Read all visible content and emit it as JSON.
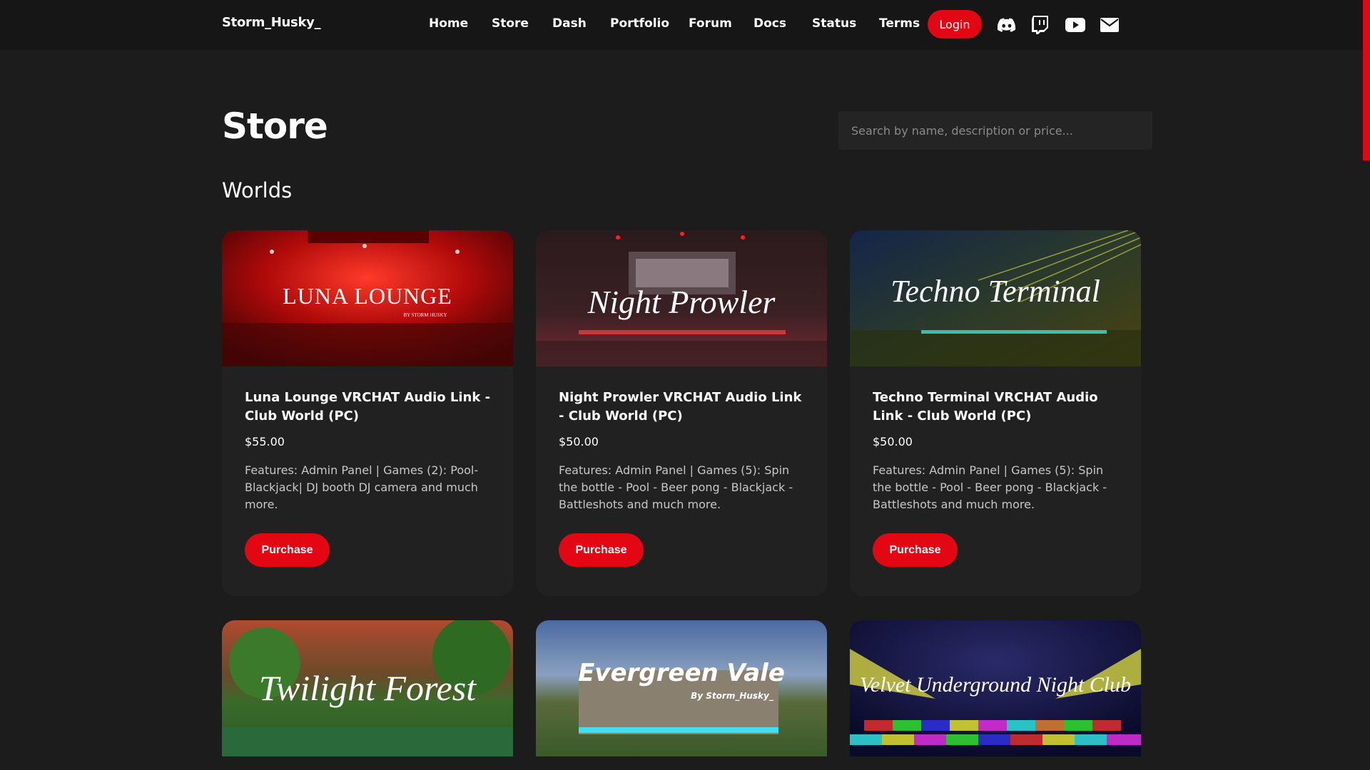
{
  "header": {
    "brand": "Storm_Husky_",
    "nav": [
      "Home",
      "Store",
      "Dash",
      "Portfolio",
      "Forum",
      "Docs",
      "Status",
      "Terms"
    ],
    "login_label": "Login",
    "social_icons": [
      "discord-icon",
      "twitch-icon",
      "youtube-icon",
      "mail-icon"
    ],
    "accent_color": "#e30613"
  },
  "page": {
    "title": "Store",
    "search_placeholder": "Search by name, description or price...",
    "section": "Worlds"
  },
  "products": [
    {
      "banner": "LUNA LOUNGE",
      "banner_sub": "BY STORM HUSKY",
      "title": "Luna Lounge VRCHAT Audio Link - Club World (PC)",
      "price": "$55.00",
      "description": "Features: Admin Panel | Games (2): Pool- Blackjack| DJ booth DJ camera and much more.",
      "button": "Purchase"
    },
    {
      "banner": "Night Prowler",
      "title": "Night Prowler VRCHAT Audio Link - Club World (PC)",
      "price": "$50.00",
      "description": "Features: Admin Panel | Games (5): Spin the bottle - Pool - Beer pong - Blackjack - Battleshots and much more.",
      "button": "Purchase"
    },
    {
      "banner": "Techno Terminal",
      "title": "Techno Terminal VRCHAT Audio Link - Club World (PC)",
      "price": "$50.00",
      "description": "Features: Admin Panel | Games (5): Spin the bottle - Pool - Beer pong - Blackjack - Battleshots and much more.",
      "button": "Purchase"
    }
  ],
  "products_row2": [
    {
      "banner": "Twilight Forest"
    },
    {
      "banner": "Evergreen Vale",
      "banner_sub": "By Storm_Husky_"
    },
    {
      "banner": "Velvet Underground Night Club"
    }
  ]
}
